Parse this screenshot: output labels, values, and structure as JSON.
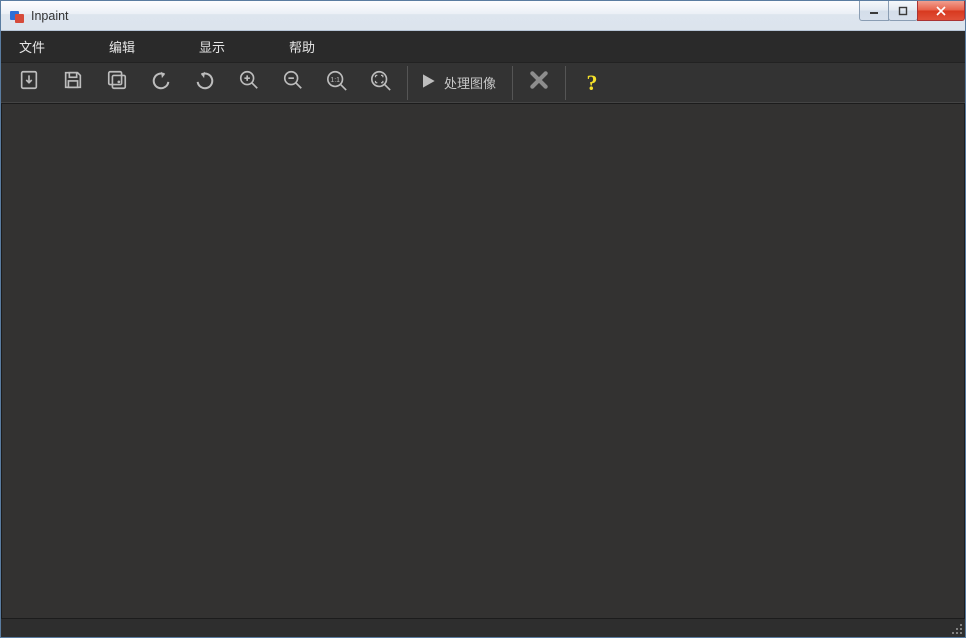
{
  "window": {
    "title": "Inpaint"
  },
  "menubar": {
    "items": [
      {
        "label": "文件"
      },
      {
        "label": "编辑"
      },
      {
        "label": "显示"
      },
      {
        "label": "帮助"
      }
    ]
  },
  "toolbar": {
    "process_label": "处理图像",
    "icons": {
      "open": "open-file-icon",
      "save": "save-icon",
      "batch": "batch-icon",
      "undo": "undo-icon",
      "redo": "redo-icon",
      "zoom_in": "zoom-in-icon",
      "zoom_out": "zoom-out-icon",
      "zoom_actual": "zoom-actual-icon",
      "zoom_fit": "zoom-fit-icon",
      "play": "play-icon",
      "cancel": "cancel-icon",
      "help": "help-icon"
    }
  }
}
